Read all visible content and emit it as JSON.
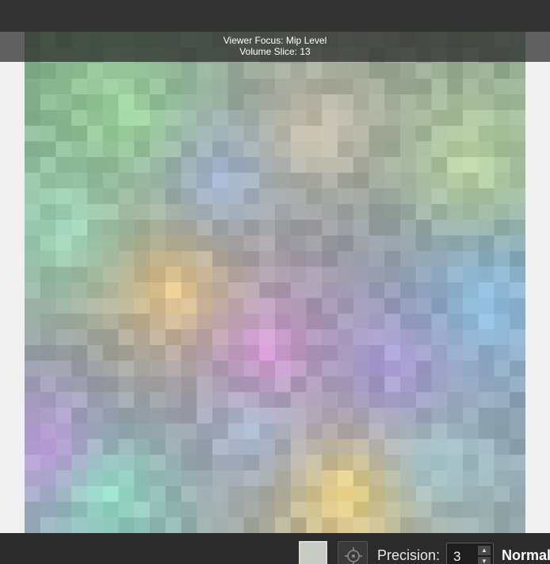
{
  "overlay": {
    "focus_text": "Viewer Focus: Mip Level",
    "slice_text": "Volume Slice: 13"
  },
  "toolbar": {
    "swatch_color": "#c8cbc2",
    "focus_button_icon": "crosshair-icon",
    "precision_label": "Precision:",
    "precision_value": "3",
    "mode_label": "Normal"
  },
  "colors": {
    "top_bar": "#343434",
    "bottom_bar": "#2b2b2b",
    "viewport_background": "#f0f0f0"
  }
}
